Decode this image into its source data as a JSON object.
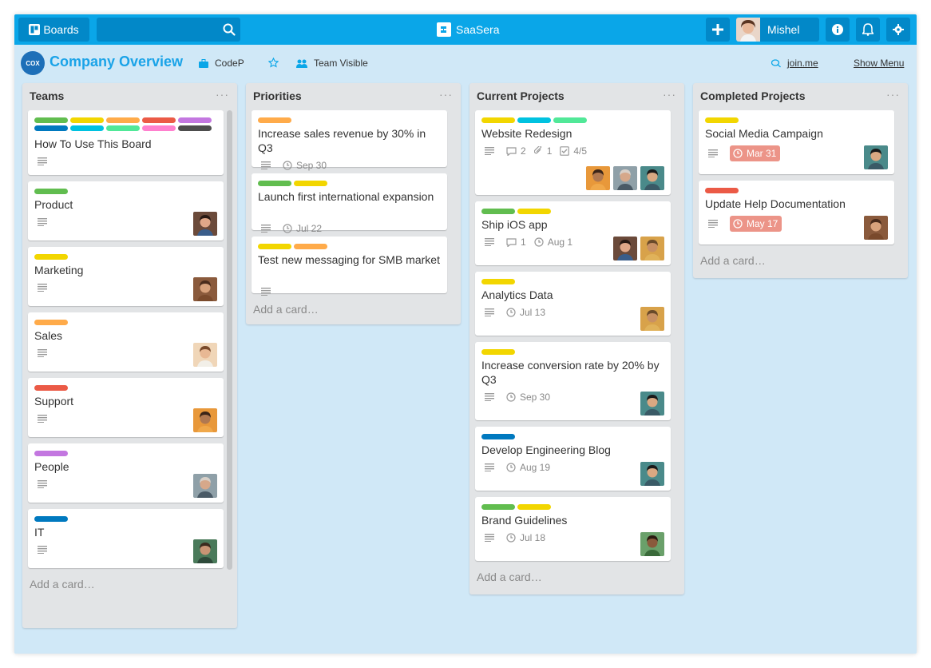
{
  "topbar": {
    "boards_label": "Boards",
    "search_value": "",
    "brand_name": "SaaSera",
    "user_name": "Mishel",
    "color": "#0aa6e8",
    "button_color": "#0288c8"
  },
  "board": {
    "logo_text": "COX",
    "title": "Company Overview",
    "org": "CodeP",
    "visibility": "Team Visible",
    "join_label": "join.me",
    "menu_label": "Show Menu"
  },
  "colors": {
    "green": "#61bd4f",
    "yellow": "#f2d600",
    "orange": "#ffab4a",
    "red": "#eb5a46",
    "purple": "#c377e0",
    "blue": "#0079bf",
    "sky": "#00c2e0",
    "lime": "#51e898",
    "pink": "#ff80ce",
    "black": "#4d4d4d",
    "due_red": "#ec9488"
  },
  "lists": [
    {
      "title": "Teams",
      "add_label": "Add a card…",
      "cards": [
        {
          "title": "How To Use This Board",
          "labels": [
            "green",
            "yellow",
            "orange",
            "red",
            "purple",
            "blue",
            "sky",
            "lime",
            "pink",
            "black"
          ],
          "avatars": []
        },
        {
          "title": "Product",
          "labels": [
            "green"
          ],
          "avatars": [
            "a-dark"
          ]
        },
        {
          "title": "Marketing",
          "labels": [
            "yellow"
          ],
          "avatars": [
            "a-brown"
          ]
        },
        {
          "title": "Sales",
          "labels": [
            "orange"
          ],
          "avatars": [
            "a-light"
          ]
        },
        {
          "title": "Support",
          "labels": [
            "red"
          ],
          "avatars": [
            "a-orange"
          ]
        },
        {
          "title": "People",
          "labels": [
            "purple"
          ],
          "avatars": [
            "a-grey"
          ]
        },
        {
          "title": "IT",
          "labels": [
            "blue"
          ],
          "avatars": [
            "a-green"
          ]
        }
      ]
    },
    {
      "title": "Priorities",
      "add_label": "Add a card…",
      "cards": [
        {
          "title": "Increase sales revenue by 30% in Q3",
          "labels": [
            "orange"
          ],
          "due": "Sep 30"
        },
        {
          "title": "Launch first international expansion",
          "labels": [
            "green",
            "yellow"
          ],
          "due": "Jul 22"
        },
        {
          "title": "Test new messaging for SMB market",
          "labels": [
            "yellow",
            "orange"
          ]
        }
      ]
    },
    {
      "title": "Current Projects",
      "add_label": "Add a card…",
      "cards": [
        {
          "title": "Website Redesign",
          "labels": [
            "yellow",
            "sky",
            "lime"
          ],
          "comments": "2",
          "attachments": "1",
          "checklist": "4/5",
          "avatars": [
            "a-orange",
            "a-grey",
            "a-teal"
          ]
        },
        {
          "title": "Ship iOS app",
          "labels": [
            "green",
            "yellow"
          ],
          "comments": "1",
          "due": "Aug 1",
          "avatars": [
            "a-dark",
            "a-gold"
          ]
        },
        {
          "title": "Analytics Data",
          "labels": [
            "yellow"
          ],
          "due": "Jul 13",
          "avatars": [
            "a-gold"
          ]
        },
        {
          "title": "Increase conversion rate by 20% by Q3",
          "labels": [
            "yellow"
          ],
          "due": "Sep 30",
          "avatars": [
            "a-teal"
          ]
        },
        {
          "title": "Develop Engineering Blog",
          "labels": [
            "blue"
          ],
          "due": "Aug 19",
          "avatars": [
            "a-teal"
          ]
        },
        {
          "title": "Brand Guidelines",
          "labels": [
            "green",
            "yellow"
          ],
          "due": "Jul 18",
          "avatars": [
            "a-leaf"
          ]
        }
      ]
    },
    {
      "title": "Completed Projects",
      "add_label": "Add a card…",
      "cards": [
        {
          "title": "Social Media Campaign",
          "labels": [
            "yellow"
          ],
          "due_red": "Mar 31",
          "avatars": [
            "a-teal"
          ]
        },
        {
          "title": "Update Help Documentation",
          "labels": [
            "red"
          ],
          "due_red": "May 17",
          "avatars": [
            "a-brown"
          ]
        }
      ]
    }
  ]
}
